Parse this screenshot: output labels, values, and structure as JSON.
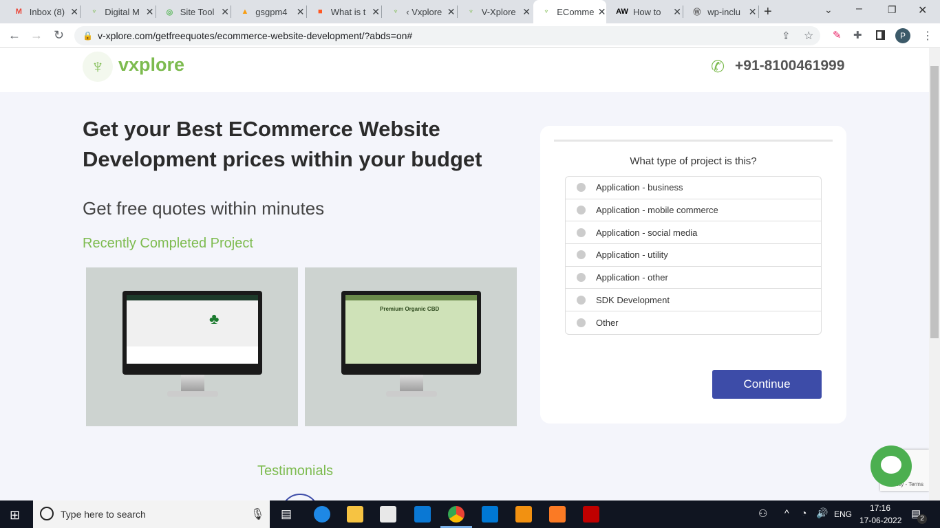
{
  "browser": {
    "tabs": [
      {
        "label": "Inbox (8)",
        "icon": "gmail-icon",
        "color": "#ea4335"
      },
      {
        "label": "Digital M",
        "icon": "vxplore-icon",
        "color": "#7dbb4f"
      },
      {
        "label": "Site Tool",
        "icon": "sitetool-icon",
        "color": "#5cb85c"
      },
      {
        "label": "gsgpm4",
        "icon": "phpmyadmin-icon",
        "color": "#f89c0e"
      },
      {
        "label": "What is t",
        "icon": "blogger-icon",
        "color": "#ff5722"
      },
      {
        "label": "‹ Vxplore",
        "icon": "vxplore-icon",
        "color": "#7dbb4f"
      },
      {
        "label": "V-Xplore",
        "icon": "vxplore-icon",
        "color": "#7dbb4f"
      },
      {
        "label": "EComme",
        "icon": "vxplore-icon",
        "color": "#7dbb4f",
        "active": true
      },
      {
        "label": "How to",
        "icon": "aw-icon",
        "color": "#000000"
      },
      {
        "label": "wp-inclu",
        "icon": "wordpress-icon",
        "color": "#666666"
      }
    ],
    "url": "v-xplore.com/getfreequotes/ecommerce-website-development/?abds=on#",
    "profile": "P"
  },
  "header": {
    "logo": "vxplore",
    "phone": "+91-8100461999"
  },
  "hero": {
    "title": "Get your Best ECommerce Website Development prices within your budget",
    "subtitle": "Get free quotes within minutes",
    "recent": "Recently Completed Project",
    "project2_text": "Premium Organic CBD"
  },
  "form": {
    "question": "What type of project is this?",
    "options": [
      "Application - business",
      "Application - mobile commerce",
      "Application - social media",
      "Application - utility",
      "Application - other",
      "SDK Development",
      "Other"
    ],
    "continue": "Continue"
  },
  "testimonials": "Testimonials",
  "recaptcha": "Privacy - Terms",
  "taskbar": {
    "search_placeholder": "Type here to search",
    "lang": "ENG",
    "time": "17:16",
    "date": "17-06-2022",
    "notifications": "2"
  },
  "colors": {
    "accent": "#7dbb4f",
    "button": "#3d4ca8",
    "chat": "#4caf50"
  }
}
